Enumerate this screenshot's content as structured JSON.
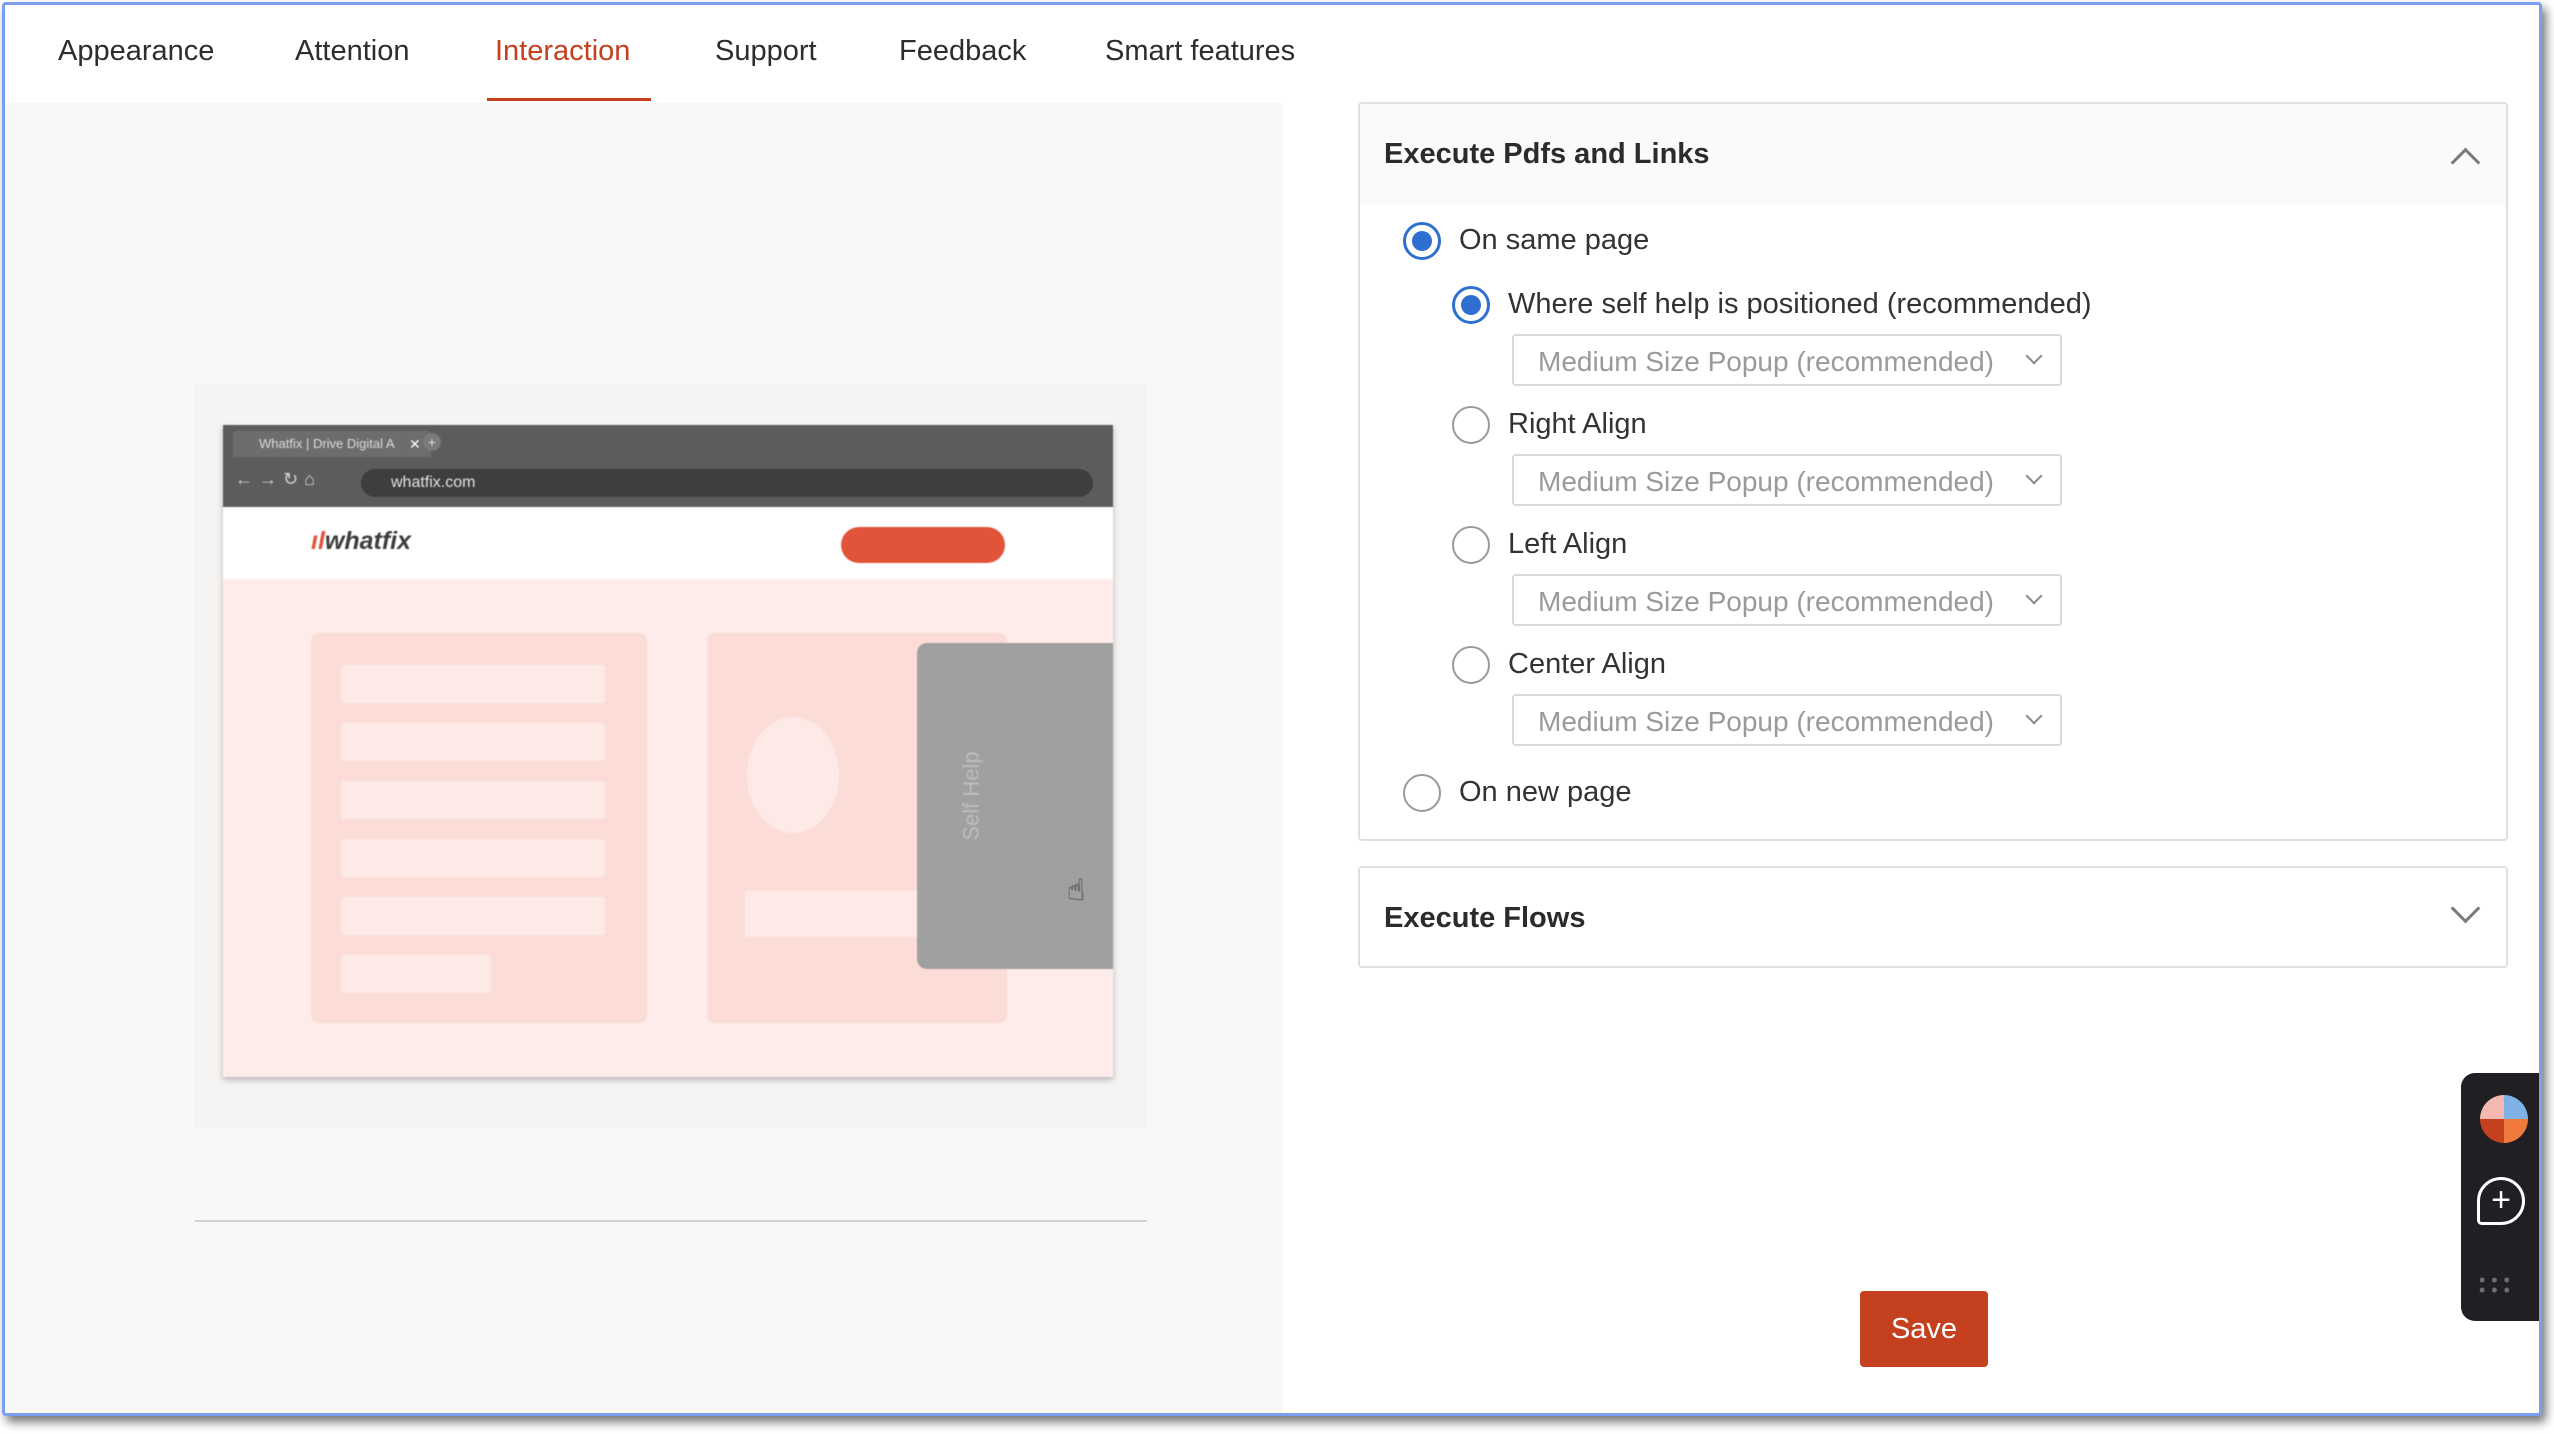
{
  "tabs": [
    {
      "label": "Appearance"
    },
    {
      "label": "Attention"
    },
    {
      "label": "Interaction"
    },
    {
      "label": "Support"
    },
    {
      "label": "Feedback"
    },
    {
      "label": "Smart features"
    }
  ],
  "active_tab": "Interaction",
  "preview": {
    "browser_tab_title": "Whatfix | Drive Digital A",
    "address": "whatfix.com",
    "logo_text": "whatfix",
    "self_help_label": "Self Help"
  },
  "pdfs_section": {
    "title": "Execute Pdfs and Links",
    "expanded": true,
    "options": {
      "same_page": "On same page",
      "new_page": "On new page"
    },
    "sub_options": [
      {
        "label": "Where self help is positioned (recommended)",
        "selected": true,
        "popup": "Medium Size Popup (recommended)"
      },
      {
        "label": "Right Align",
        "selected": false,
        "popup": "Medium Size Popup (recommended)"
      },
      {
        "label": "Left Align",
        "selected": false,
        "popup": "Medium Size Popup (recommended)"
      },
      {
        "label": "Center Align",
        "selected": false,
        "popup": "Medium Size Popup (recommended)"
      }
    ]
  },
  "flows_section": {
    "title": "Execute Flows",
    "expanded": false
  },
  "save_label": "Save",
  "colors": {
    "accent": "#c4401f",
    "radio": "#2f6fd1"
  }
}
